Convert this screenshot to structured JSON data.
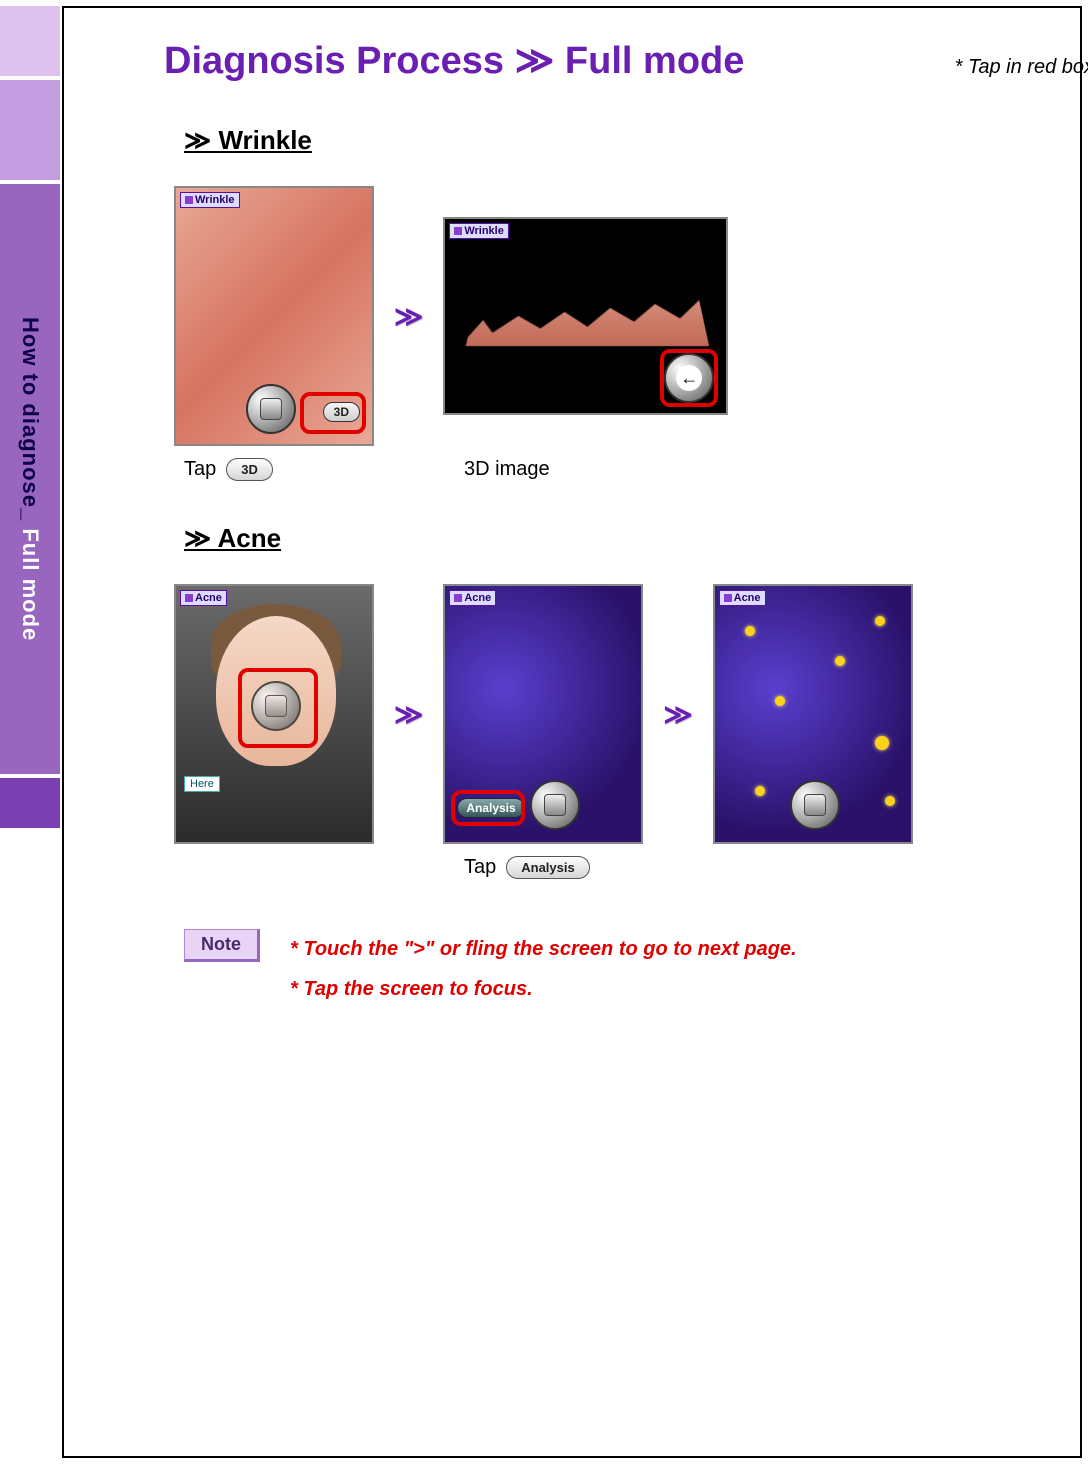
{
  "sidebar": {
    "label_part1": "How to diagnose_ ",
    "label_part2": "Full mode"
  },
  "header": {
    "title": "Diagnosis Process ≫ Full mode",
    "legend": "* Tap in red box"
  },
  "sections": {
    "wrinkle": {
      "heading": "≫  Wrinkle",
      "badge": "Wrinkle",
      "tap_label": "Tap",
      "tap_button": "3D",
      "result_label": "3D image"
    },
    "acne": {
      "heading": "≫  Acne",
      "badge": "Acne",
      "here_label": "Here",
      "analysis_button": "Analysis",
      "tap_label": "Tap"
    }
  },
  "notes": {
    "badge": "Note",
    "line1": "* Touch the \">\" or fling the screen to go to next page.",
    "line2": "* Tap the screen to focus."
  },
  "icons": {
    "back_arrow": "←",
    "step_arrow": "≫"
  }
}
